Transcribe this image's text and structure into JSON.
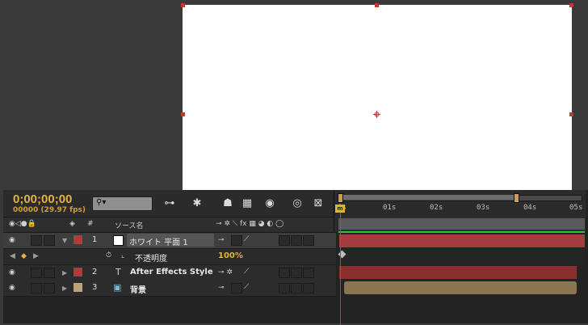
{
  "timeline": {
    "timecode": "0;00;00;00",
    "frames": "00000 (29.97 fps)",
    "search_icon": "magnifier-dropdown",
    "columns": {
      "num": "#",
      "source_name": "ソース名"
    },
    "ruler_ticks": [
      "0s",
      "01s",
      "02s",
      "03s",
      "04s",
      "05s"
    ]
  },
  "layers": [
    {
      "number": "1",
      "name": "ホワイト 平面 1",
      "color": "#b33a3a",
      "bar_color": "#a33d3d",
      "selected": true
    },
    {
      "number": "2",
      "name": "After Effects Style",
      "color": "#b33a3a",
      "bar_color": "#8b2e2e"
    },
    {
      "number": "3",
      "name": "背景",
      "color": "#bfa27a",
      "bar_color": "#8a7452"
    }
  ],
  "property": {
    "name": "不透明度",
    "value": "100%"
  }
}
